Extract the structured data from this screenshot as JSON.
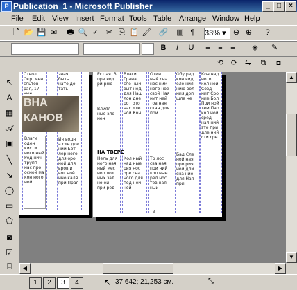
{
  "window": {
    "title": "Publication_1 - Microsoft Publisher",
    "app_icon": "P"
  },
  "menu": [
    "File",
    "Edit",
    "View",
    "Insert",
    "Format",
    "Tools",
    "Table",
    "Arrange",
    "Window",
    "Help"
  ],
  "standard_toolbar": {
    "zoom": "33%"
  },
  "formatting_toolbar": {
    "bold": "B",
    "italic": "I",
    "underline": "U"
  },
  "document": {
    "photo_text": [
      "ВНА",
      "КАНОВ"
    ],
    "heading": "НА ТВЕРЕ",
    "page_number": "3"
  },
  "status": {
    "pages": [
      "1",
      "2",
      "3",
      "4"
    ],
    "active_page": "3",
    "position": "37,642; 21,253 см."
  }
}
